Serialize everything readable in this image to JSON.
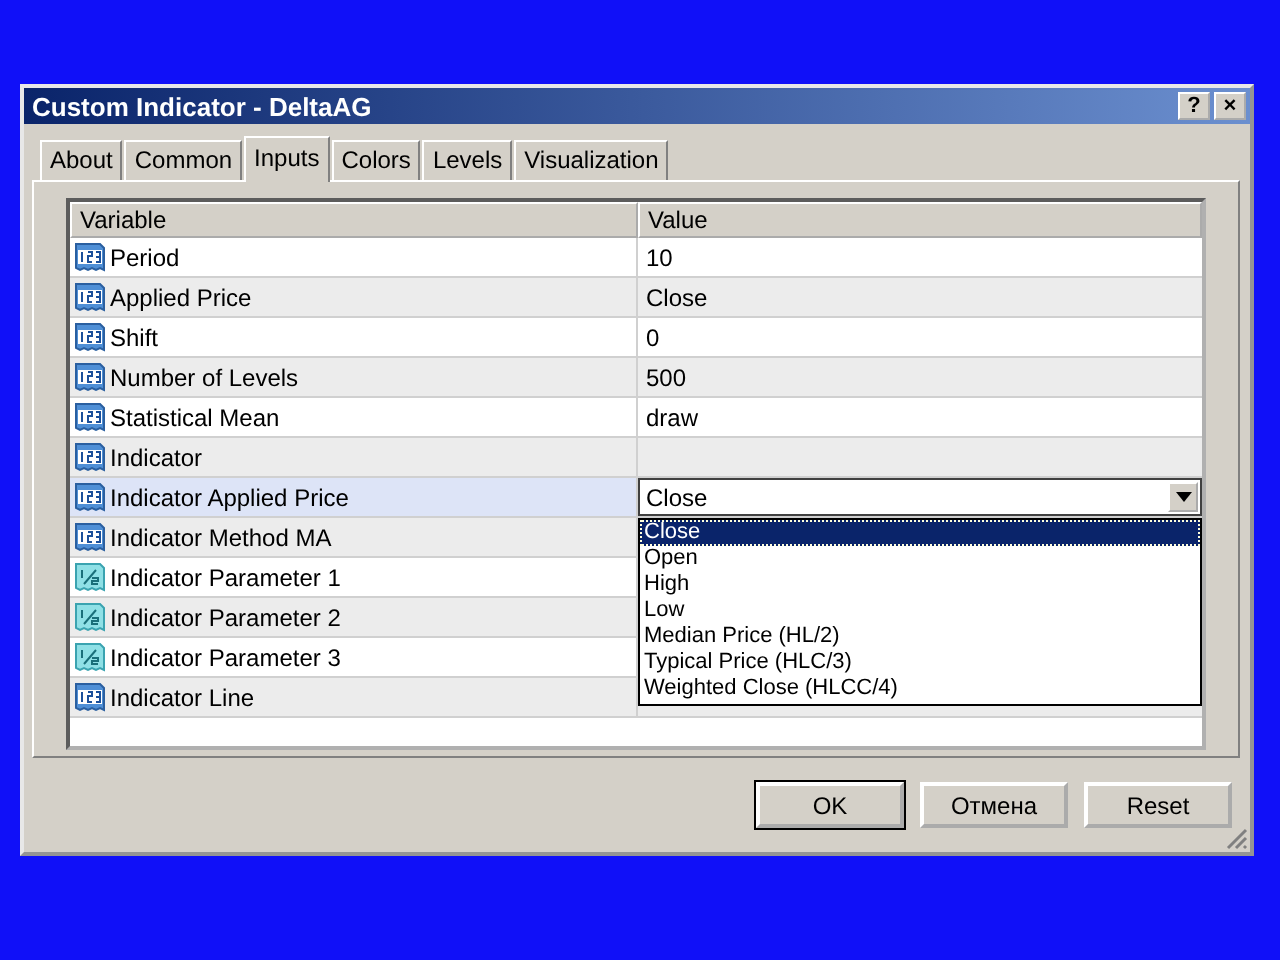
{
  "window": {
    "title": "Custom Indicator - DeltaAG",
    "title_buttons": [
      "?",
      "×"
    ]
  },
  "tabs": [
    {
      "label": "About",
      "selected": false
    },
    {
      "label": "Common",
      "selected": false
    },
    {
      "label": "Inputs",
      "selected": true
    },
    {
      "label": "Colors",
      "selected": false
    },
    {
      "label": "Levels",
      "selected": false
    },
    {
      "label": "Visualization",
      "selected": false
    }
  ],
  "table": {
    "columns": [
      "Variable",
      "Value"
    ],
    "rows": [
      {
        "variable": "Period",
        "value": "10",
        "kind": "int",
        "selected": false
      },
      {
        "variable": "Applied Price",
        "value": "Close",
        "kind": "int",
        "selected": false
      },
      {
        "variable": "Shift",
        "value": "0",
        "kind": "int",
        "selected": false
      },
      {
        "variable": "Number of Levels",
        "value": "500",
        "kind": "int",
        "selected": false
      },
      {
        "variable": "Statistical Mean",
        "value": "draw",
        "kind": "int",
        "selected": false
      },
      {
        "variable": "Indicator",
        "kind": "int",
        "selected": false
      },
      {
        "variable": "Indicator Applied Price",
        "kind": "int",
        "selected": true,
        "editor": {
          "value": "Close",
          "options": [
            {
              "label": "Close",
              "selected": true
            },
            {
              "label": "Open",
              "selected": false
            },
            {
              "label": "High",
              "selected": false
            },
            {
              "label": "Low",
              "selected": false
            },
            {
              "label": "Median Price (HL/2)",
              "selected": false
            },
            {
              "label": "Typical Price (HLC/3)",
              "selected": false
            },
            {
              "label": "Weighted Close (HLCC/4)",
              "selected": false
            }
          ]
        }
      },
      {
        "variable": "Indicator Method MA",
        "kind": "int",
        "selected": false
      },
      {
        "variable": "Indicator Parameter 1",
        "kind": "double",
        "selected": false
      },
      {
        "variable": "Indicator Parameter 2",
        "kind": "double",
        "selected": false
      },
      {
        "variable": "Indicator Parameter 3",
        "kind": "double",
        "selected": false
      },
      {
        "variable": "Indicator Line",
        "kind": "int",
        "selected": false
      }
    ]
  },
  "buttons": [
    {
      "label": "OK",
      "default": true
    },
    {
      "label": "Отмена",
      "default": false
    },
    {
      "label": "Reset",
      "default": false
    }
  ]
}
